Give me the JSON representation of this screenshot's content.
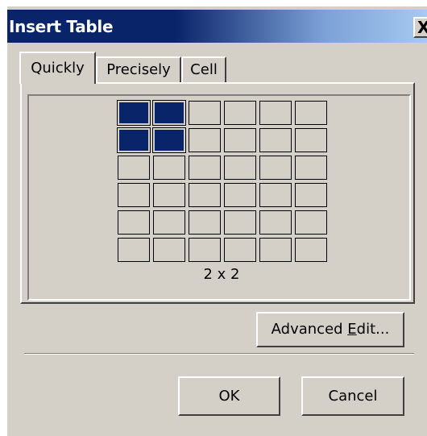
{
  "window": {
    "title": "Insert Table",
    "close_label": "X"
  },
  "tabs": [
    {
      "label": "Quickly",
      "active": true
    },
    {
      "label": "Precisely",
      "active": false
    },
    {
      "label": "Cell",
      "active": false
    }
  ],
  "grid": {
    "rows": 6,
    "columns": 6,
    "selected_rows": 2,
    "selected_columns": 2,
    "selection_label": "2 x 2",
    "selected_color": "#0a246a"
  },
  "buttons": {
    "advanced_edit": {
      "prefix": "Advanced ",
      "accel": "E",
      "suffix": "dit..."
    },
    "ok": "OK",
    "cancel": "Cancel"
  }
}
